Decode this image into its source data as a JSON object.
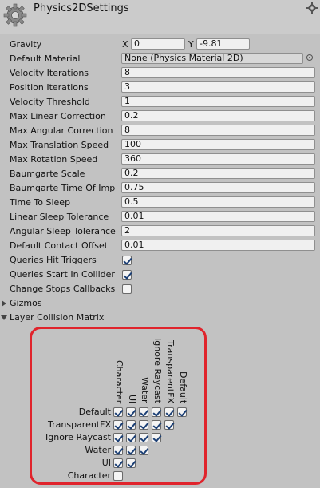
{
  "header": {
    "title": "Physics2DSettings",
    "icon": "gear-icon",
    "menu_icon": "gear-menu-icon"
  },
  "gravity": {
    "label": "Gravity",
    "x_label": "X",
    "x_value": "0",
    "y_label": "Y",
    "y_value": "-9.81"
  },
  "default_material": {
    "label": "Default Material",
    "value": "None (Physics Material 2D)"
  },
  "properties": [
    {
      "label": "Velocity Iterations",
      "value": "8"
    },
    {
      "label": "Position Iterations",
      "value": "3"
    },
    {
      "label": "Velocity Threshold",
      "value": "1"
    },
    {
      "label": "Max Linear Correction",
      "value": "0.2"
    },
    {
      "label": "Max Angular Correction",
      "value": "8"
    },
    {
      "label": "Max Translation Speed",
      "value": "100"
    },
    {
      "label": "Max Rotation Speed",
      "value": "360"
    },
    {
      "label": "Baumgarte Scale",
      "value": "0.2"
    },
    {
      "label": "Baumgarte Time Of Imp",
      "value": "0.75"
    },
    {
      "label": "Time To Sleep",
      "value": "0.5"
    },
    {
      "label": "Linear Sleep Tolerance",
      "value": "0.01"
    },
    {
      "label": "Angular Sleep Tolerance",
      "value": "2"
    },
    {
      "label": "Default Contact Offset",
      "value": "0.01"
    }
  ],
  "toggles": [
    {
      "label": "Queries Hit Triggers",
      "checked": true
    },
    {
      "label": "Queries Start In Collider",
      "checked": true
    },
    {
      "label": "Change Stops Callbacks",
      "checked": false
    }
  ],
  "gizmos": {
    "label": "Gizmos",
    "expanded": false
  },
  "layer_matrix": {
    "label": "Layer Collision Matrix",
    "expanded": true,
    "columns": [
      "Character",
      "UI",
      "Water",
      "Ignore Raycast",
      "TransparentFX",
      "Default"
    ],
    "rows": [
      {
        "label": "Default",
        "checks": [
          true,
          true,
          true,
          true,
          true,
          true
        ]
      },
      {
        "label": "TransparentFX",
        "checks": [
          true,
          true,
          true,
          true,
          true
        ]
      },
      {
        "label": "Ignore Raycast",
        "checks": [
          true,
          true,
          true,
          true
        ]
      },
      {
        "label": "Water",
        "checks": [
          true,
          true,
          true
        ]
      },
      {
        "label": "UI",
        "checks": [
          true,
          true
        ]
      },
      {
        "label": "Character",
        "checks": [
          false
        ]
      }
    ],
    "highlight_color": "#e0242c"
  }
}
